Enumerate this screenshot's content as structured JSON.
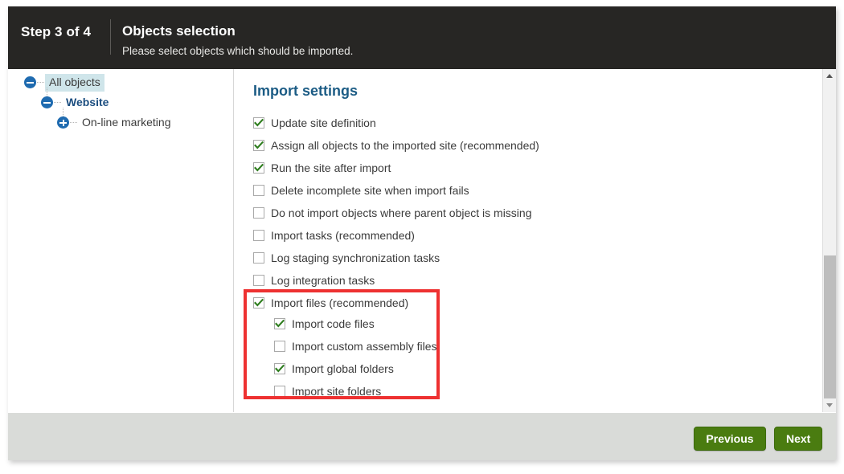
{
  "header": {
    "step": "Step 3 of 4",
    "title": "Objects selection",
    "subtitle": "Please select objects which should be imported."
  },
  "tree": {
    "nodes": [
      {
        "label": "All objects",
        "toggle": "minus-icon",
        "selected": true,
        "level": 0
      },
      {
        "label": "Website",
        "toggle": "minus-icon",
        "selected": false,
        "level": 1
      },
      {
        "label": "On-line marketing",
        "toggle": "plus-icon",
        "selected": false,
        "level": 2
      }
    ]
  },
  "settings": {
    "title": "Import settings",
    "options": [
      {
        "label": "Update site definition",
        "checked": true,
        "indent": 0
      },
      {
        "label": "Assign all objects to the imported site (recommended)",
        "checked": true,
        "indent": 0
      },
      {
        "label": "Run the site after import",
        "checked": true,
        "indent": 0
      },
      {
        "label": "Delete incomplete site when import fails",
        "checked": false,
        "indent": 0
      },
      {
        "label": "Do not import objects where parent object is missing",
        "checked": false,
        "indent": 0
      },
      {
        "label": "Import tasks (recommended)",
        "checked": false,
        "indent": 0
      },
      {
        "label": "Log staging synchronization tasks",
        "checked": false,
        "indent": 0
      },
      {
        "label": "Log integration tasks",
        "checked": false,
        "indent": 0
      },
      {
        "label": "Import files (recommended)",
        "checked": true,
        "indent": 0
      },
      {
        "label": "Import code files",
        "checked": true,
        "indent": 1
      },
      {
        "label": "Import custom assembly files",
        "checked": false,
        "indent": 1
      },
      {
        "label": "Import global folders",
        "checked": true,
        "indent": 1
      },
      {
        "label": "Import site folders",
        "checked": false,
        "indent": 1
      }
    ]
  },
  "annotation": {
    "color": "#ee3131"
  },
  "scrollbar": {
    "up_icon": "triangle-up-icon",
    "down_icon": "triangle-down-icon"
  },
  "footer": {
    "previous_label": "Previous",
    "next_label": "Next",
    "button_color": "#4a7c10"
  }
}
